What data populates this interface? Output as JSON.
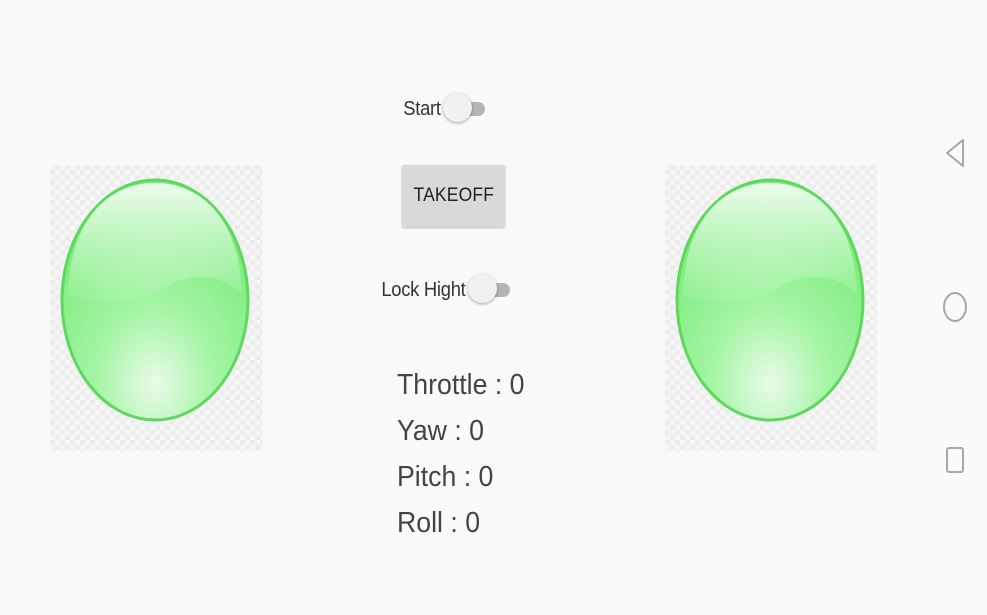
{
  "controls": {
    "start_label": "Start",
    "start_on": false,
    "takeoff_label": "TAKEOFF",
    "lock_height_label": "Lock Hight",
    "lock_height_on": false
  },
  "telemetry": {
    "throttle": "Throttle : 0",
    "yaw": "Yaw : 0",
    "pitch": "Pitch : 0",
    "roll": "Roll : 0"
  },
  "joysticks": {
    "left_icon": "joystick-knob",
    "right_icon": "joystick-knob",
    "color": "#7df07d"
  },
  "navigation": {
    "back_icon": "back-triangle-icon",
    "home_icon": "home-circle-icon",
    "recents_icon": "recents-square-icon"
  }
}
